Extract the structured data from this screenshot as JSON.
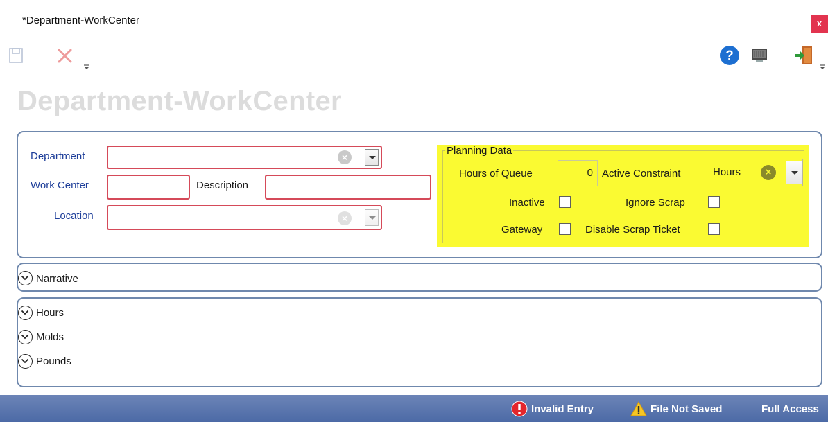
{
  "window": {
    "title": "*Department-WorkCenter",
    "close_label": "x"
  },
  "page": {
    "heading": "Department-WorkCenter"
  },
  "form": {
    "department_label": "Department",
    "department_value": "",
    "work_center_label": "Work Center",
    "work_center_value": "",
    "description_label": "Description",
    "description_value": "",
    "location_label": "Location",
    "location_value": ""
  },
  "planning": {
    "group_label": "Planning Data",
    "hours_of_queue_label": "Hours of Queue",
    "hours_of_queue_value": "0",
    "active_constraint_label": "Active Constraint",
    "active_constraint_value": "Hours",
    "inactive_label": "Inactive",
    "ignore_scrap_label": "Ignore Scrap",
    "gateway_label": "Gateway",
    "disable_scrap_ticket_label": "Disable Scrap Ticket",
    "inactive_checked": false,
    "ignore_scrap_checked": false,
    "gateway_checked": false,
    "disable_scrap_ticket_checked": false
  },
  "sections": {
    "narrative": "Narrative",
    "hours": "Hours",
    "molds": "Molds",
    "pounds": "Pounds"
  },
  "status": {
    "invalid_entry": "Invalid Entry",
    "file_not_saved": "File Not Saved",
    "full_access": "Full Access"
  },
  "colors": {
    "accent_blue": "#4c6aa6",
    "invalid_red": "#d54a59",
    "highlight_yellow": "#fafa32"
  }
}
